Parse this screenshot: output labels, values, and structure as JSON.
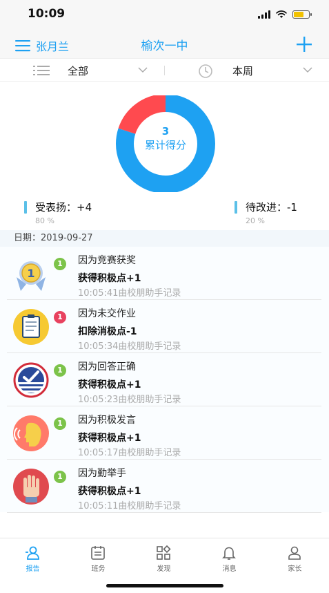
{
  "status_bar": {
    "time": "10:09"
  },
  "nav": {
    "user_name": "张月兰",
    "title": "榆次一中"
  },
  "filters": {
    "category": "全部",
    "period": "本周"
  },
  "summary": {
    "total_score": "3",
    "total_label": "累计得分",
    "praise_label": "受表扬：+4",
    "praise_percent": "80 %",
    "improve_label": "待改进：-1",
    "improve_percent": "20 %",
    "praise_fraction": 0.8,
    "improve_fraction": 0.2,
    "colors": {
      "praise": "#1ea1f2",
      "improve": "#ff4a4f"
    }
  },
  "date_label": "日期：2019-09-27",
  "records": [
    {
      "icon": "medal-icon",
      "badge": "1",
      "badge_type": "pos",
      "reason": "因为竞赛获奖",
      "points": "获得积极点+1",
      "meta": "10:05:41由校朋助手记录"
    },
    {
      "icon": "clipboard-icon",
      "badge": "1",
      "badge_type": "neg",
      "reason": "因为未交作业",
      "points": "扣除消极点-1",
      "meta": "10:05:34由校朋助手记录"
    },
    {
      "icon": "checkmark-shield-icon",
      "badge": "1",
      "badge_type": "pos",
      "reason": "因为回答正确",
      "points": "获得积极点+1",
      "meta": "10:05:23由校朋助手记录"
    },
    {
      "icon": "speaking-head-icon",
      "badge": "1",
      "badge_type": "pos",
      "reason": "因为积极发言",
      "points": "获得积极点+1",
      "meta": "10:05:17由校朋助手记录"
    },
    {
      "icon": "raised-hand-icon",
      "badge": "1",
      "badge_type": "pos",
      "reason": "因为勤举手",
      "points": "获得积极点+1",
      "meta": "10:05:11由校朋助手记录"
    }
  ],
  "tabs": [
    {
      "label": "报告",
      "icon": "report-icon",
      "active": true
    },
    {
      "label": "班务",
      "icon": "calendar-icon",
      "active": false
    },
    {
      "label": "发现",
      "icon": "grid-icon",
      "active": false
    },
    {
      "label": "消息",
      "icon": "bell-icon",
      "active": false
    },
    {
      "label": "家长",
      "icon": "person-icon",
      "active": false
    }
  ]
}
